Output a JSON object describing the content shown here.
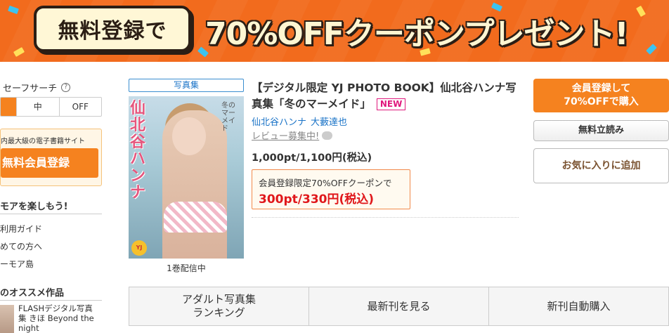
{
  "banner": {
    "pill_text": "無料登録で",
    "headline": "70%OFFクーポンプレゼント!"
  },
  "sidebar": {
    "safe_search_label": "セーフサーチ",
    "help_icon": "?",
    "safe_search_options": [
      "",
      "中",
      "OFF"
    ],
    "safe_search_selected": 0,
    "register_caption": "内最大級の電子書籍サイト",
    "register_button": "無料会員登録",
    "section_enjoy": "モアを楽しもう!",
    "links": [
      "利用ガイド",
      "めての方へ",
      "ーモア島"
    ],
    "section_recommend": "のオススメ作品",
    "recommend_item": "FLASHデジタル写真集 きほ Beyond the night"
  },
  "product": {
    "category_tag": "写真集",
    "cover_title": "仙北谷ハンナ",
    "cover_subtitle": "冬のマーメイド",
    "volume_status": "1巻配信中",
    "title": "【デジタル限定 YJ PHOTO BOOK】仙北谷ハンナ写真集「冬のマーメイド」",
    "new_badge": "NEW",
    "authors": [
      "仙北谷ハンナ",
      "大藪達也"
    ],
    "review_link": "レビュー募集中!",
    "price": "1,000pt/1,100円(税込)",
    "coupon_line1": "会員登録限定70%OFFクーポンで",
    "coupon_price": "300pt/330円(税込)"
  },
  "actions": {
    "buy_button": "会員登録して\n70%OFFで購入",
    "free_read_button": "無料立読み",
    "favorite_button": "お気に入りに追加"
  },
  "tabs": [
    "アダルト写真集\nランキング",
    "最新刊を見る",
    "新刊自動購入"
  ],
  "colors": {
    "accent_orange": "#f5821f",
    "banner_orange": "#f26b1d",
    "link_blue": "#1a73c7",
    "price_red": "#e0171b",
    "new_pink": "#e0197d"
  }
}
